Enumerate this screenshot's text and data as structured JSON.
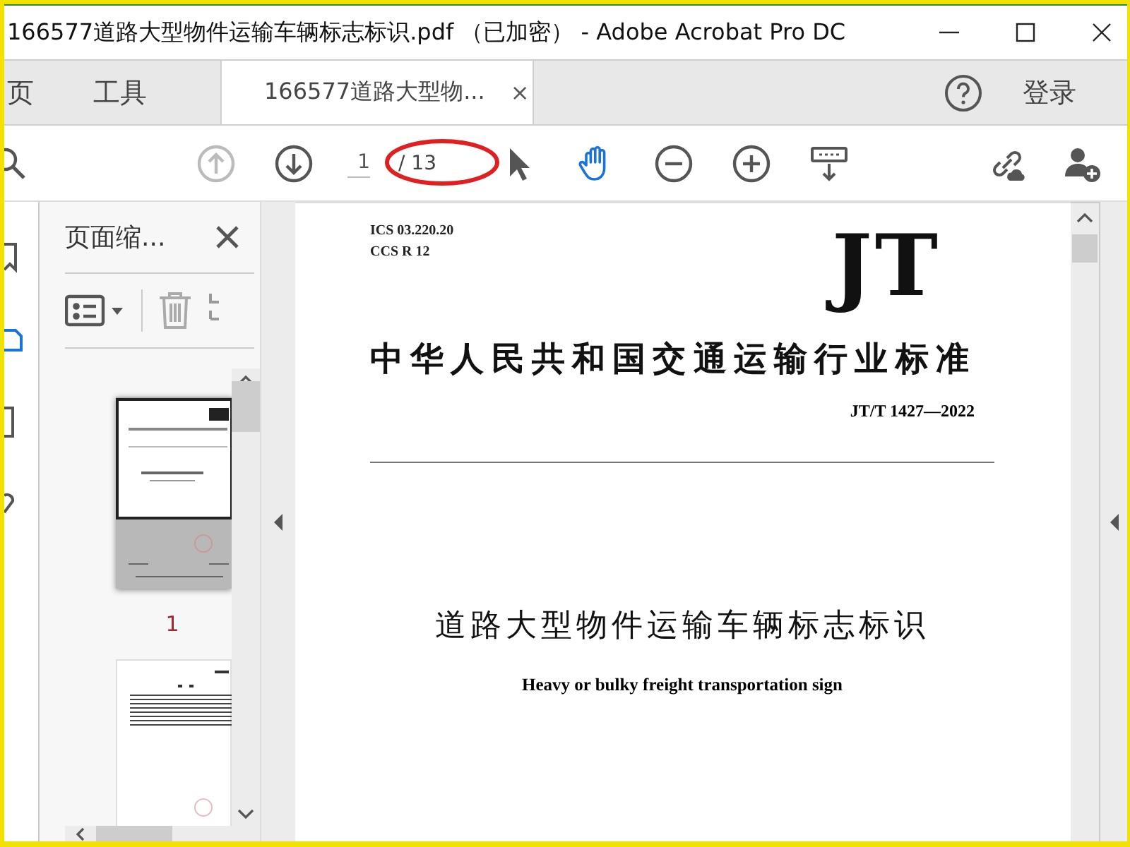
{
  "window": {
    "title": "166577道路大型物件运输车辆标志标识.pdf （已加密） - Adobe Acrobat Pro DC"
  },
  "tabs": [
    {
      "label": "页",
      "selected": false
    },
    {
      "label": "工具",
      "selected": false
    },
    {
      "label": "166577道路大型物...",
      "selected": true,
      "close": "×"
    }
  ],
  "account": {
    "sign_in": "登录"
  },
  "toolbar": {
    "previous_disabled": true,
    "page": "1",
    "total": "/ 13",
    "tools": [
      {
        "kind": "select",
        "selected": false
      },
      {
        "kind": "hand",
        "selected": true
      }
    ]
  },
  "thumbnails_panel": {
    "title": "页面缩...",
    "delete_disabled": true,
    "pages": [
      {
        "kind": "cover",
        "label": "1",
        "selected": true
      },
      {
        "kind": "contents",
        "selected": false
      }
    ]
  },
  "document": {
    "ics": "ICS 03.220.20",
    "ccs": "CCS R 12",
    "logo": "JT",
    "standard_title": "中华人民共和国交通运输行业标准",
    "code": "JT/T 1427—2022",
    "title": "道路大型物件运输车辆标志标识",
    "subtitle": "Heavy or bulky freight transportation sign"
  }
}
